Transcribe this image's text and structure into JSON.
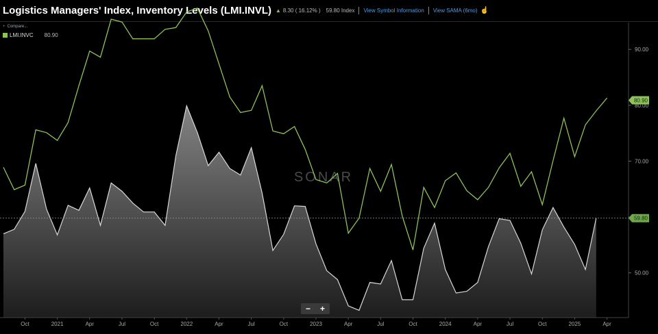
{
  "header": {
    "title": "Logistics Managers' Index, Inventory Levels (LMI.INVL)",
    "change": "8.30 ( 16.12% )",
    "value": "59.80 Index",
    "link_info": "View Symbol Information",
    "link_sama": "View SAMA (6mo)"
  },
  "compare_label": "Compare...",
  "legend": {
    "name": "LMI.INVC",
    "value": "80.90"
  },
  "watermark": "SONAR",
  "zoom": {
    "minus": "−",
    "plus": "+"
  },
  "colors": {
    "green": "#8fc25a",
    "white_line": "#d9d9d9",
    "area": "#7a7a7a",
    "background": "#000000"
  },
  "chart_data": {
    "type": "line",
    "x": [
      "2020-08",
      "2020-09",
      "2020-10",
      "2020-11",
      "2020-12",
      "2021-01",
      "2021-02",
      "2021-03",
      "2021-04",
      "2021-05",
      "2021-06",
      "2021-07",
      "2021-08",
      "2021-09",
      "2021-10",
      "2021-11",
      "2021-12",
      "2022-01",
      "2022-02",
      "2022-03",
      "2022-04",
      "2022-05",
      "2022-06",
      "2022-07",
      "2022-08",
      "2022-09",
      "2022-10",
      "2022-11",
      "2022-12",
      "2023-01",
      "2023-02",
      "2023-03",
      "2023-04",
      "2023-05",
      "2023-06",
      "2023-07",
      "2023-08",
      "2023-09",
      "2023-10",
      "2023-11",
      "2023-12",
      "2024-01",
      "2024-02",
      "2024-03",
      "2024-04",
      "2024-05",
      "2024-06",
      "2024-07",
      "2024-08",
      "2024-09",
      "2024-10",
      "2024-11",
      "2024-12",
      "2025-01",
      "2025-02",
      "2025-03",
      "2025-04",
      "2025-05",
      "2025-06"
    ],
    "series": [
      {
        "name": "LMI.INVC",
        "color": "#8fc25a",
        "style": "line",
        "values": [
          68.9,
          64.9,
          65.7,
          75.6,
          75.1,
          73.7,
          76.9,
          83.5,
          89.7,
          88.6,
          95.4,
          94.9,
          91.9,
          91.9,
          91.9,
          93.6,
          93.9,
          96.7,
          97.4,
          93.3,
          87.4,
          81.5,
          78.7,
          79.1,
          83.5,
          75.4,
          74.9,
          76.2,
          72.1,
          66.7,
          66.1,
          67.8,
          57.1,
          59.8,
          68.7,
          64.6,
          69.4,
          60.2,
          54.1,
          65.3,
          61.7,
          66.5,
          67.9,
          64.7,
          63.1,
          65.3,
          68.8,
          71.4,
          65.5,
          68.1,
          62.2,
          70.1,
          77.7,
          70.8,
          76.5,
          79.0,
          81.3
        ]
      },
      {
        "name": "LMI.INVL",
        "color": "#d9d9d9",
        "style": "area",
        "values": [
          57.0,
          57.8,
          61.0,
          69.6,
          61.4,
          56.8,
          62.1,
          61.2,
          65.2,
          58.5,
          66.1,
          64.6,
          62.5,
          60.9,
          60.9,
          58.5,
          71.0,
          79.9,
          75.1,
          69.2,
          71.6,
          68.7,
          67.5,
          72.4,
          64.3,
          54.0,
          56.9,
          62.0,
          61.9,
          55.2,
          50.4,
          48.8,
          44.1,
          43.3,
          48.3,
          48.0,
          52.2,
          45.2,
          45.2,
          54.4,
          58.9,
          50.6,
          46.4,
          46.7,
          48.3,
          54.7,
          59.7,
          59.4,
          55.3,
          49.8,
          57.7,
          61.7,
          58.2,
          55.1,
          50.6,
          59.8
        ]
      }
    ],
    "y_ticks": [
      50,
      60,
      70,
      80,
      90
    ],
    "y_tick_labels": [
      "50.00",
      "60.00",
      "70.00",
      "80.00",
      "90.00"
    ],
    "ylim": [
      42,
      94.8
    ],
    "x_tick_labels": [
      {
        "date": "2020-10",
        "label": "Oct"
      },
      {
        "date": "2021-01",
        "label": "2021"
      },
      {
        "date": "2021-04",
        "label": "Apr"
      },
      {
        "date": "2021-07",
        "label": "Jul"
      },
      {
        "date": "2021-10",
        "label": "Oct"
      },
      {
        "date": "2022-01",
        "label": "2022"
      },
      {
        "date": "2022-04",
        "label": "Apr"
      },
      {
        "date": "2022-07",
        "label": "Jul"
      },
      {
        "date": "2022-10",
        "label": "Oct"
      },
      {
        "date": "2023-01",
        "label": "2023"
      },
      {
        "date": "2023-04",
        "label": "Apr"
      },
      {
        "date": "2023-07",
        "label": "Jul"
      },
      {
        "date": "2023-10",
        "label": "Oct"
      },
      {
        "date": "2024-01",
        "label": "2024"
      },
      {
        "date": "2024-04",
        "label": "Apr"
      },
      {
        "date": "2024-07",
        "label": "Jul"
      },
      {
        "date": "2024-10",
        "label": "Oct"
      },
      {
        "date": "2025-01",
        "label": "2025"
      },
      {
        "date": "2025-04",
        "label": "Apr"
      }
    ],
    "last_value_labels": [
      {
        "series": "LMI.INVC",
        "value": 80.9,
        "label": "80.90"
      },
      {
        "series": "LMI.INVL",
        "value": 59.8,
        "label": "59.80"
      }
    ],
    "reference_line": {
      "value": 59.8,
      "style": "dashed"
    },
    "grid": false,
    "legend_position": "top-left"
  }
}
